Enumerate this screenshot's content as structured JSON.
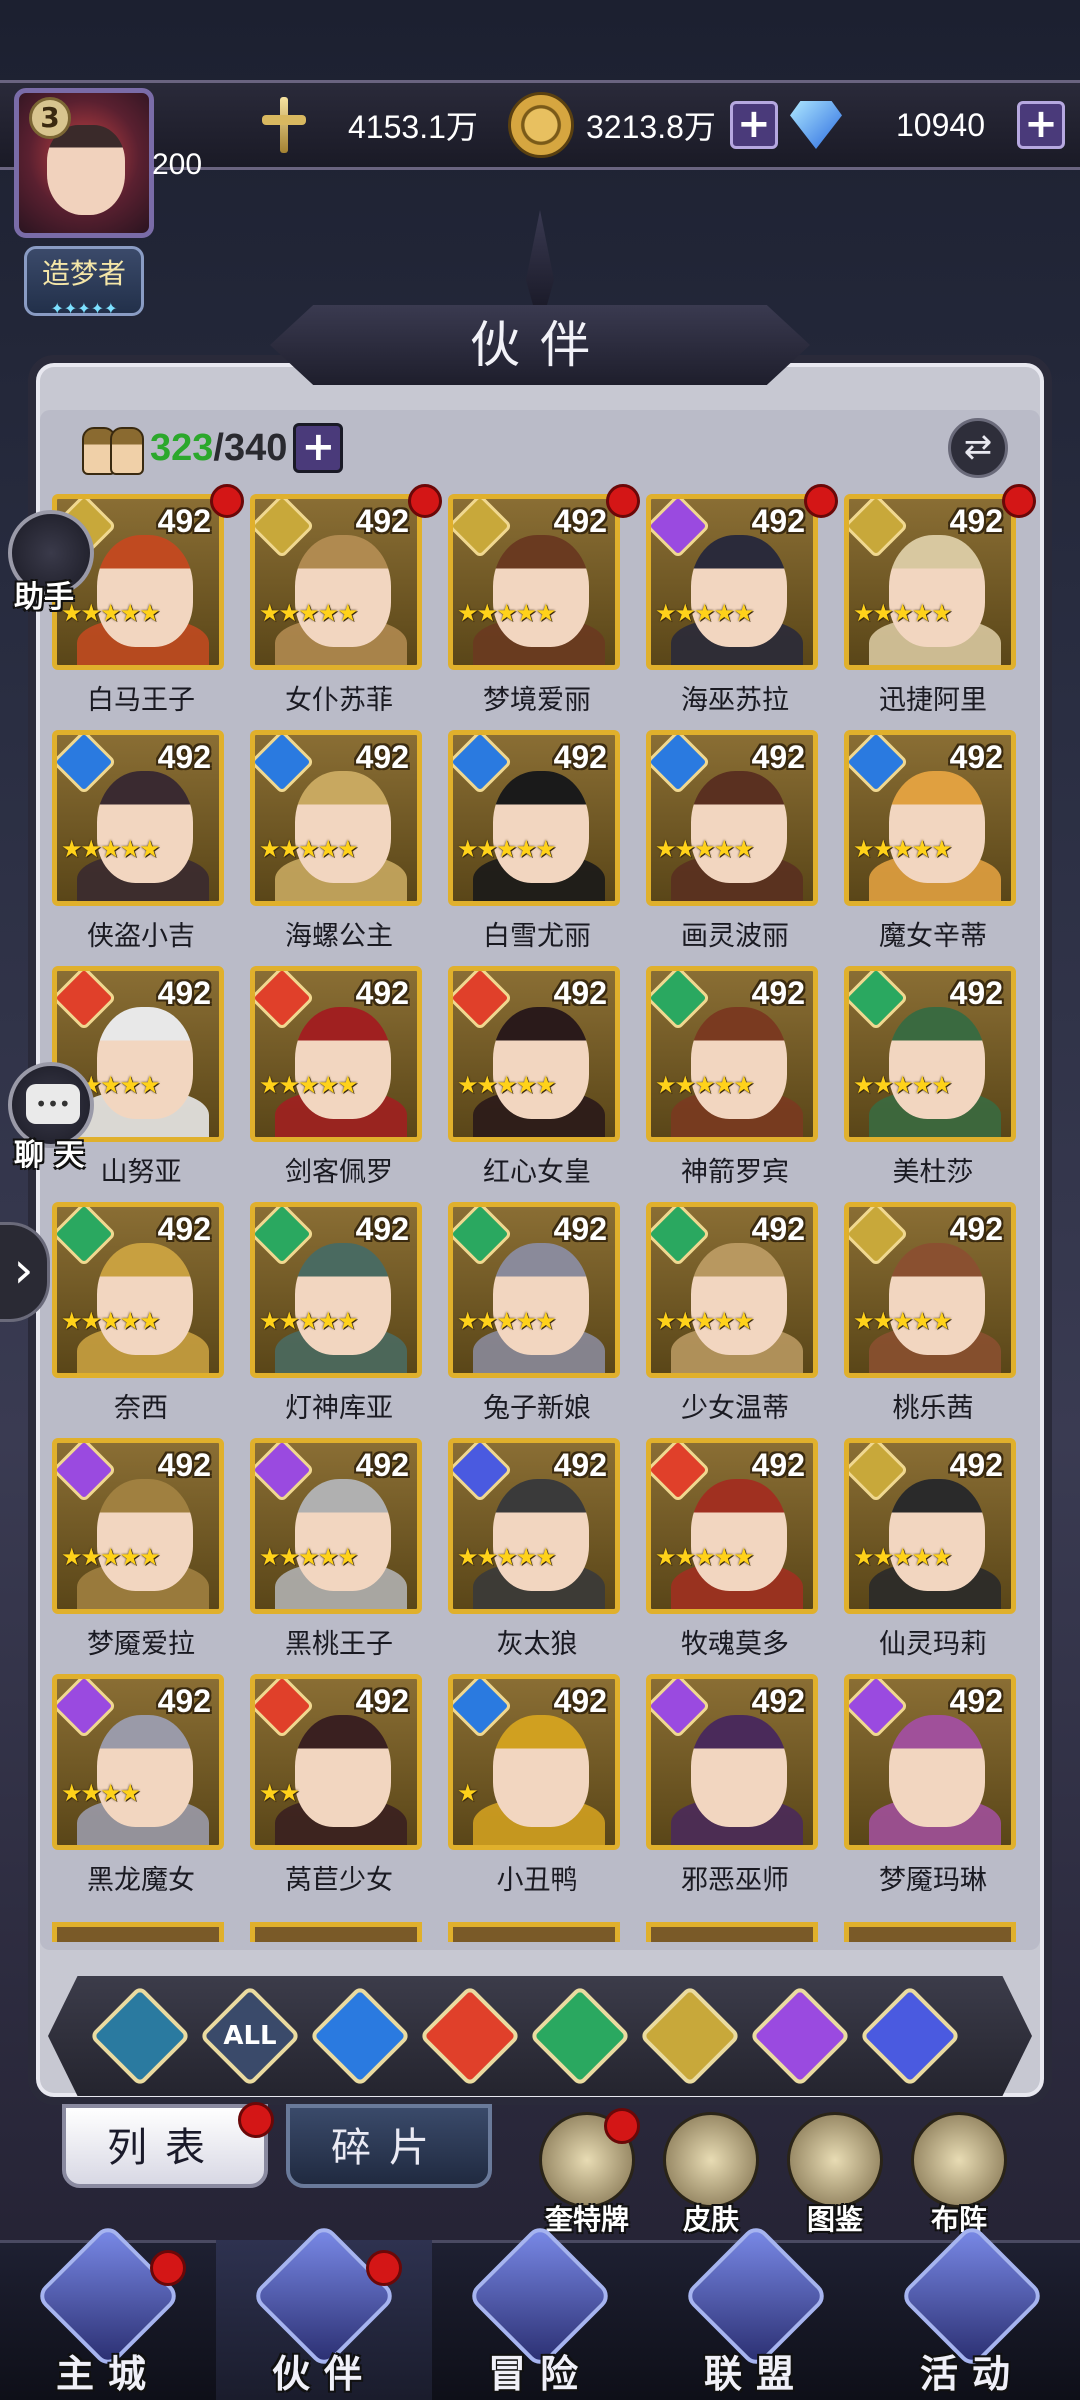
{
  "player": {
    "level": "3",
    "vip": "200",
    "title": "造梦者"
  },
  "resources": {
    "power": "4153.1万",
    "gold": "3213.8万",
    "diamonds": "10940"
  },
  "panel": {
    "title": "伙伴",
    "owned": "323",
    "capacity": "/340"
  },
  "side": {
    "assist": "助手",
    "chat": "聊 天"
  },
  "heroes": [
    {
      "name": "白马王子",
      "level": "492",
      "stars": 5,
      "elem": "light",
      "dot": true
    },
    {
      "name": "女仆苏菲",
      "level": "492",
      "stars": 5,
      "elem": "light",
      "dot": true
    },
    {
      "name": "梦境爱丽",
      "level": "492",
      "stars": 5,
      "elem": "light",
      "dot": true
    },
    {
      "name": "海巫苏拉",
      "level": "492",
      "stars": 5,
      "elem": "dark",
      "dot": true
    },
    {
      "name": "迅捷阿里",
      "level": "492",
      "stars": 5,
      "elem": "light",
      "dot": true
    },
    {
      "name": "侠盗小吉",
      "level": "492",
      "stars": 5,
      "elem": "water",
      "dot": false
    },
    {
      "name": "海螺公主",
      "level": "492",
      "stars": 5,
      "elem": "water",
      "dot": false
    },
    {
      "name": "白雪尤丽",
      "level": "492",
      "stars": 5,
      "elem": "water",
      "dot": false
    },
    {
      "name": "画灵波丽",
      "level": "492",
      "stars": 5,
      "elem": "water",
      "dot": false
    },
    {
      "name": "魔女辛蒂",
      "level": "492",
      "stars": 5,
      "elem": "water",
      "dot": false
    },
    {
      "name": "山努亚",
      "level": "492",
      "stars": 5,
      "elem": "fire",
      "dot": false
    },
    {
      "name": "剑客佩罗",
      "level": "492",
      "stars": 5,
      "elem": "fire",
      "dot": false
    },
    {
      "name": "红心女皇",
      "level": "492",
      "stars": 5,
      "elem": "fire",
      "dot": false
    },
    {
      "name": "神箭罗宾",
      "level": "492",
      "stars": 5,
      "elem": "wind",
      "dot": false
    },
    {
      "name": "美杜莎",
      "level": "492",
      "stars": 5,
      "elem": "wind",
      "dot": false
    },
    {
      "name": "奈西",
      "level": "492",
      "stars": 5,
      "elem": "wind",
      "dot": false
    },
    {
      "name": "灯神库亚",
      "level": "492",
      "stars": 5,
      "elem": "wind",
      "dot": false
    },
    {
      "name": "兔子新娘",
      "level": "492",
      "stars": 5,
      "elem": "wind",
      "dot": false
    },
    {
      "name": "少女温蒂",
      "level": "492",
      "stars": 5,
      "elem": "wind",
      "dot": false
    },
    {
      "name": "桃乐茜",
      "level": "492",
      "stars": 5,
      "elem": "light",
      "dot": false
    },
    {
      "name": "梦魇爱拉",
      "level": "492",
      "stars": 5,
      "elem": "dark",
      "dot": false
    },
    {
      "name": "黑桃王子",
      "level": "492",
      "stars": 5,
      "elem": "dark",
      "dot": false
    },
    {
      "name": "灰太狼",
      "level": "492",
      "stars": 5,
      "elem": "cosmic",
      "dot": false
    },
    {
      "name": "牧魂莫多",
      "level": "492",
      "stars": 5,
      "elem": "fire",
      "dot": false
    },
    {
      "name": "仙灵玛莉",
      "level": "492",
      "stars": 5,
      "elem": "light",
      "dot": false
    },
    {
      "name": "黑龙魔女",
      "level": "492",
      "stars": 4,
      "elem": "dark",
      "dot": false
    },
    {
      "name": "莴苣少女",
      "level": "492",
      "stars": 2,
      "elem": "fire",
      "dot": false
    },
    {
      "name": "小丑鸭",
      "level": "492",
      "stars": 1,
      "elem": "water",
      "dot": false
    },
    {
      "name": "邪恶巫师",
      "level": "492",
      "stars": 0,
      "elem": "dark",
      "dot": false
    },
    {
      "name": "梦魇玛琳",
      "level": "492",
      "stars": 0,
      "elem": "dark",
      "dot": false
    }
  ],
  "filters": [
    {
      "id": "shield",
      "label": ""
    },
    {
      "id": "all",
      "label": "ALL"
    },
    {
      "id": "water",
      "label": ""
    },
    {
      "id": "fire",
      "label": ""
    },
    {
      "id": "wind",
      "label": ""
    },
    {
      "id": "light",
      "label": ""
    },
    {
      "id": "dark",
      "label": ""
    },
    {
      "id": "cosmic",
      "label": ""
    }
  ],
  "tabs": {
    "list": "列表",
    "fragments": "碎片"
  },
  "tools": [
    {
      "label": "奎特牌",
      "dot": true
    },
    {
      "label": "皮肤",
      "dot": false
    },
    {
      "label": "图鉴",
      "dot": false
    },
    {
      "label": "布阵",
      "dot": false
    }
  ],
  "nav": [
    {
      "label": "主城",
      "dot": true,
      "active": false
    },
    {
      "label": "伙伴",
      "dot": true,
      "active": true
    },
    {
      "label": "冒险",
      "dot": false,
      "active": false
    },
    {
      "label": "联盟",
      "dot": false,
      "active": false
    },
    {
      "label": "活动",
      "dot": false,
      "active": false
    }
  ],
  "colors": {
    "light": "#c8a83a",
    "water": "#2a7ae0",
    "fire": "#e0402a",
    "wind": "#2aa860",
    "dark": "#9a4ae0",
    "cosmic": "#4a5ae0",
    "shield": "#2a7aa0",
    "all": "#3a4a6a",
    "card_gold": "#e0b02c"
  }
}
